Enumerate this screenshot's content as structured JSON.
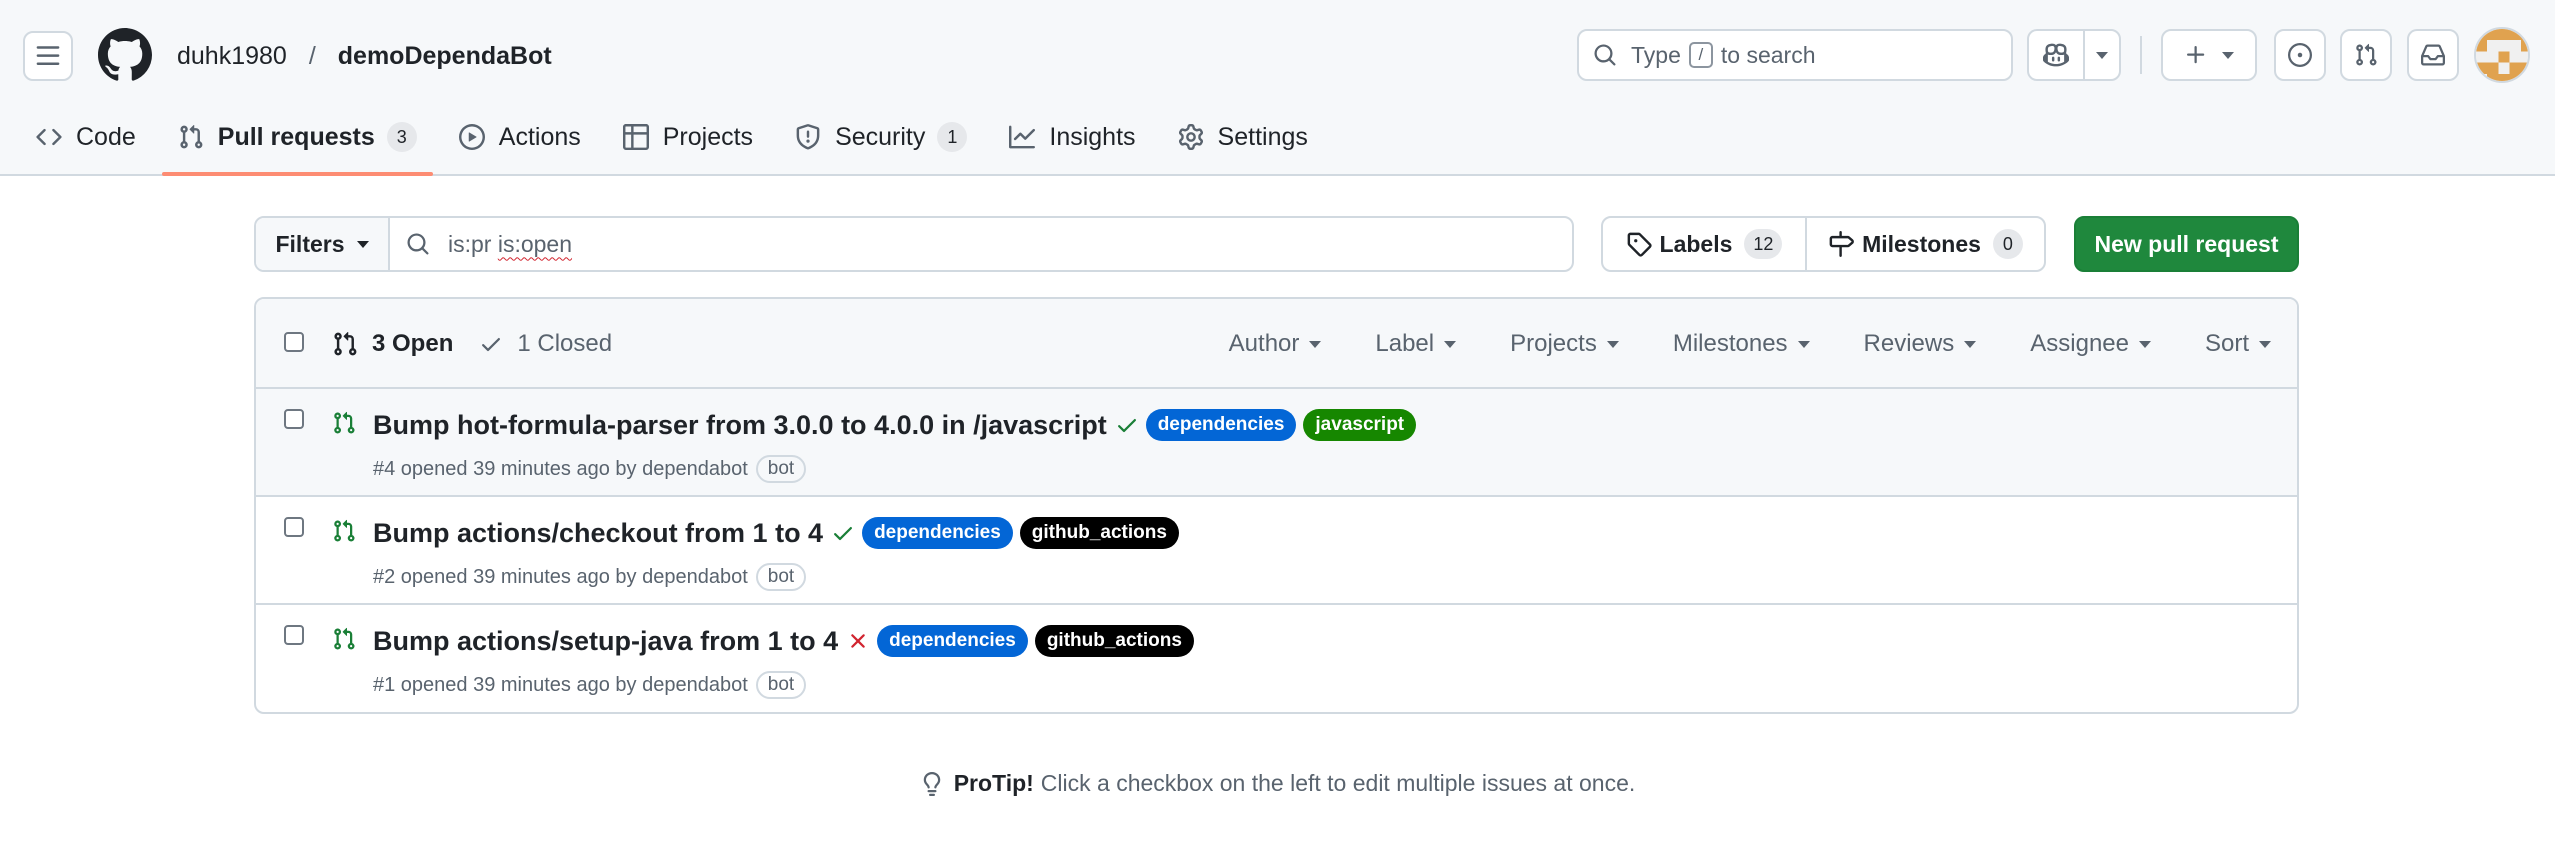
{
  "header": {
    "owner": "duhk1980",
    "separator": "/",
    "repo": "demoDependaBot",
    "search_prefix": "Type",
    "search_key": "/",
    "search_suffix": "to search"
  },
  "tabs": [
    {
      "label": "Code",
      "icon": "code-icon"
    },
    {
      "label": "Pull requests",
      "icon": "git-pull-request-icon",
      "count": "3",
      "active": true
    },
    {
      "label": "Actions",
      "icon": "play-icon"
    },
    {
      "label": "Projects",
      "icon": "table-icon"
    },
    {
      "label": "Security",
      "icon": "shield-icon",
      "count": "1"
    },
    {
      "label": "Insights",
      "icon": "graph-icon"
    },
    {
      "label": "Settings",
      "icon": "gear-icon"
    }
  ],
  "toolbar": {
    "filters_label": "Filters",
    "query_prefix": "is:pr",
    "query_open": "is:open",
    "labels_label": "Labels",
    "labels_count": "12",
    "milestones_label": "Milestones",
    "milestones_count": "0",
    "new_pr_label": "New pull request"
  },
  "list_header": {
    "open_label": "3 Open",
    "closed_label": "1 Closed",
    "filters": [
      "Author",
      "Label",
      "Projects",
      "Milestones",
      "Reviews",
      "Assignee",
      "Sort"
    ]
  },
  "pull_requests": [
    {
      "title": "Bump hot-formula-parser from 3.0.0 to 4.0.0 in /javascript",
      "status": "success",
      "labels": [
        {
          "name": "dependencies",
          "color": "#0366d6"
        },
        {
          "name": "javascript",
          "color": "#168700"
        }
      ],
      "meta": "#4 opened 39 minutes ago by dependabot",
      "badge": "bot"
    },
    {
      "title": "Bump actions/checkout from 1 to 4",
      "status": "success",
      "labels": [
        {
          "name": "dependencies",
          "color": "#0366d6"
        },
        {
          "name": "github_actions",
          "color": "#000000"
        }
      ],
      "meta": "#2 opened 39 minutes ago by dependabot",
      "badge": "bot"
    },
    {
      "title": "Bump actions/setup-java from 1 to 4",
      "status": "failure",
      "labels": [
        {
          "name": "dependencies",
          "color": "#0366d6"
        },
        {
          "name": "github_actions",
          "color": "#000000"
        }
      ],
      "meta": "#1 opened 39 minutes ago by dependabot",
      "badge": "bot"
    }
  ],
  "protip": {
    "title": "ProTip!",
    "text": "Click a checkbox on the left to edit multiple issues at once."
  },
  "colors": {
    "accent_green": "#1f883d",
    "tab_underline": "#fd8c73",
    "success": "#1a7f37",
    "failure": "#d1242f"
  }
}
